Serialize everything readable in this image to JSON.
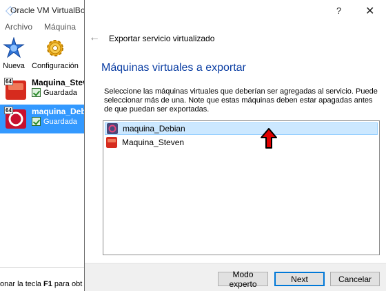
{
  "background_app": {
    "title": "Oracle VM VirtualBox",
    "menu": [
      "Archivo",
      "Máquina"
    ],
    "toolbar": [
      {
        "label": "Nueva",
        "icon": "new-machine-icon"
      },
      {
        "label": "Configuración",
        "icon": "settings-gear-icon"
      }
    ],
    "vms": [
      {
        "name": "Maquina_Steven",
        "state": "Guardada",
        "badge": "64",
        "selected": false
      },
      {
        "name": "maquina_Debian",
        "state": "Guardada",
        "badge": "64",
        "selected": true
      }
    ],
    "status_text_prefix": "onar la tecla ",
    "status_key": "F1",
    "status_text_suffix": " para obt"
  },
  "dialog": {
    "help_label": "?",
    "close_label": "✕",
    "back_label": "←",
    "heading": "Exportar servicio virtualizado",
    "page_title": "Máquinas virtuales a exportar",
    "description": "Seleccione las máquinas virtuales que deberían ser agregadas al servicio. Puede seleccionar más de una. Note que estas máquinas deben estar apagadas antes de que puedan ser exportadas.",
    "vm_list": [
      {
        "name": "maquina_Debian",
        "selected": true
      },
      {
        "name": "Maquina_Steven",
        "selected": false
      }
    ],
    "buttons": {
      "expert": "Modo experto",
      "next": "Next",
      "cancel": "Cancelar"
    }
  },
  "colors": {
    "accent": "#0078d7",
    "title_blue": "#0b3ea3",
    "selection_bg": "#cce8ff",
    "manager_selection": "#3399ff",
    "annotation_arrow": "#e00000"
  }
}
